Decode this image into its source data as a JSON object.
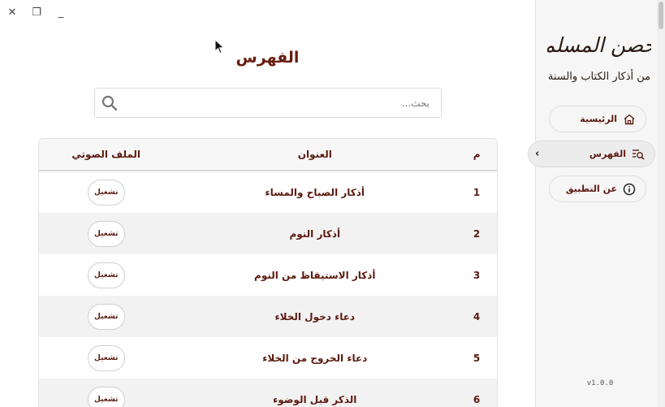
{
  "window": {
    "close_icon": "✕",
    "restore_icon": "❐",
    "minimize_icon": "_"
  },
  "main": {
    "title": "الفهرس",
    "search": {
      "placeholder": "بحث...",
      "icon": "search-icon"
    },
    "table": {
      "headers": {
        "num": "م",
        "title": "العنوان",
        "audio": "الملف الصوتي"
      },
      "rows": [
        {
          "num": "1",
          "title": "أذكار الصباح والمساء",
          "action": "تشغيل"
        },
        {
          "num": "2",
          "title": "أذكار النوم",
          "action": "تشغيل"
        },
        {
          "num": "3",
          "title": "أذكار الاستيقاظ من النوم",
          "action": "تشغيل"
        },
        {
          "num": "4",
          "title": "دعاء دخول الخلاء",
          "action": "تشغيل"
        },
        {
          "num": "5",
          "title": "دعاء الخروج من الخلاء",
          "action": "تشغيل"
        },
        {
          "num": "6",
          "title": "الذكر قبل الوضوء",
          "action": "تشغيل"
        }
      ]
    }
  },
  "sidebar": {
    "logo": {
      "line1": "حصن المسلم",
      "line2": "من أذكار الكتاب والسنة"
    },
    "nav": [
      {
        "label": "الرئيسية",
        "icon": "home-icon",
        "active": false
      },
      {
        "label": "الفهرس",
        "icon": "index-search-icon",
        "active": true,
        "chevron": "›"
      },
      {
        "label": "عن التطبيق",
        "icon": "info-icon",
        "active": false
      }
    ],
    "version": "v1.0.0"
  },
  "colors": {
    "accent": "#6a1d0f",
    "sidebar_bg": "#f6f6f6",
    "row_alt": "#f2f2f2"
  }
}
